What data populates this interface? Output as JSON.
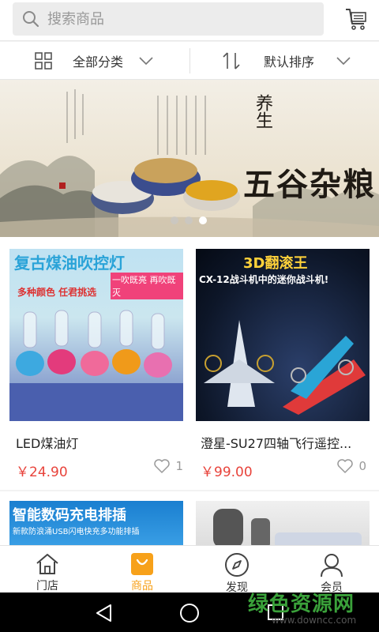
{
  "search": {
    "placeholder": "搜索商品"
  },
  "filter": {
    "category_label": "全部分类",
    "sort_label": "默认排序"
  },
  "banner": {
    "title": "五谷杂粮",
    "subtitle": "养生",
    "slides": 3,
    "active_slide": 3
  },
  "products": [
    {
      "name": "LED煤油灯",
      "price": "￥24.90",
      "likes": "1",
      "image_caption": "复古煤油吹控灯",
      "image_sub": "一吹既亮 再吹既灭",
      "image_tag": "多种颜色 任君挑选"
    },
    {
      "name": "澄星-SU27四轴飞行遥控...",
      "price": "￥99.00",
      "likes": "0",
      "image_caption": "3D翻滚王",
      "image_sub": "CX-12战斗机中的迷你战斗机!"
    },
    {
      "name": "",
      "image_caption": "智能数码充电排插",
      "image_sub": "新款防浪涌USB闪电快充多功能排插"
    },
    {
      "name": ""
    }
  ],
  "tabs": [
    {
      "label": "门店",
      "icon": "home-icon"
    },
    {
      "label": "商品",
      "icon": "bag-icon"
    },
    {
      "label": "发现",
      "icon": "compass-icon"
    },
    {
      "label": "会员",
      "icon": "user-icon"
    }
  ],
  "active_tab": "商品",
  "watermark": {
    "text": "绿色资源网",
    "url": "www.downcc.com"
  },
  "colors": {
    "accent": "#f7a11a",
    "price": "#e8433b",
    "watermark": "#3aa13a"
  }
}
